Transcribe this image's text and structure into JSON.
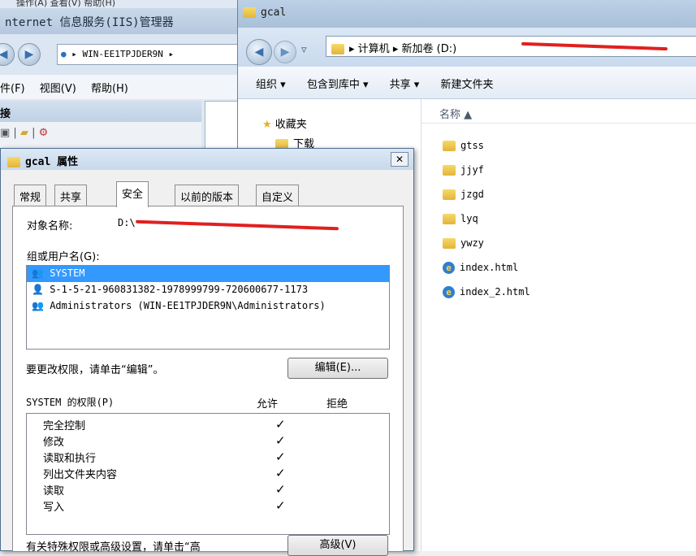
{
  "iis": {
    "topmenu": "操作(A)  查看(V)  帮助(H)",
    "title": "nternet 信息服务(IIS)管理器",
    "address": "WIN-EE1TPJDER9N",
    "menu": [
      "件(F)",
      "视图(V)",
      "帮助(H)"
    ],
    "panel_head": "接"
  },
  "explorer": {
    "title": "gcal",
    "address": [
      "计算机",
      "新加卷 (D:)"
    ],
    "commands": [
      "组织 ▾",
      "包含到库中 ▾",
      "共享 ▾",
      "新建文件夹"
    ],
    "tree": [
      {
        "label": "收藏夹",
        "icon": "star-icon"
      },
      {
        "label": "下载",
        "icon": "folder-icon"
      }
    ],
    "column_name": "名称 ▲",
    "files": [
      {
        "name": "gtss",
        "type": "folder"
      },
      {
        "name": "jjyf",
        "type": "folder"
      },
      {
        "name": "jzgd",
        "type": "folder"
      },
      {
        "name": "lyq",
        "type": "folder"
      },
      {
        "name": "ywzy",
        "type": "folder"
      },
      {
        "name": "index.html",
        "type": "html"
      },
      {
        "name": "index_2.html",
        "type": "html"
      }
    ]
  },
  "dialog": {
    "title": "gcal 属性",
    "tabs": [
      "常规",
      "共享",
      "安全",
      "以前的版本",
      "自定义"
    ],
    "object_label": "对象名称:",
    "object_value": "D:\\",
    "group_label": "组或用户名(G):",
    "groups": [
      "SYSTEM",
      "S-1-5-21-960831382-1978999799-720600677-1173",
      "Administrators (WIN-EE1TPJDER9N\\Administrators)"
    ],
    "change_hint": "要更改权限，请单击“编辑”。",
    "edit_button": "编辑(E)...",
    "perm_header": "SYSTEM 的权限(P)",
    "allow_header": "允许",
    "deny_header": "拒绝",
    "permissions": [
      "完全控制",
      "修改",
      "读取和执行",
      "列出文件夹内容",
      "读取",
      "写入"
    ],
    "check_mark": "✓",
    "advanced_hint": "有关特殊权限或高级设置，请单击“高",
    "advanced_button": "高级(V)"
  }
}
